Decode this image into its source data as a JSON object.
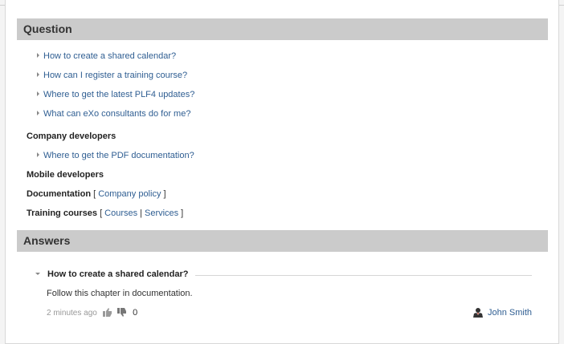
{
  "question_section": {
    "title": "Question",
    "items": [
      "How to create a shared calendar?",
      "How can I register a training course?",
      "Where to get the latest PLF4 updates?",
      "What can eXo consultants do for me?"
    ]
  },
  "categories": {
    "company_developers": {
      "label": "Company developers",
      "items": [
        "Where to get the PDF documentation?"
      ]
    },
    "mobile_developers": {
      "label": "Mobile developers"
    },
    "documentation": {
      "label": "Documentation",
      "open_bracket": "[",
      "link": "Company policy",
      "close_bracket": "]"
    },
    "training_courses": {
      "label": "Training courses",
      "open_bracket": "[",
      "link1": "Courses",
      "separator": "|",
      "link2": "Services",
      "close_bracket": "]"
    }
  },
  "answers_section": {
    "title": "Answers",
    "answer_title": "How to create a shared calendar?",
    "answer_body": "Follow this chapter in documentation.",
    "time_ago": "2 minutes ago",
    "vote_count": "0",
    "author": "John Smith"
  },
  "icons": {
    "arrow": "caret-right-icon",
    "expand": "caret-down-icon",
    "like": "thumbs-up-icon",
    "dislike": "thumbs-down-icon",
    "user": "user-icon"
  },
  "colors": {
    "link": "#2f5e92",
    "header_bg": "#cbcbcb"
  }
}
